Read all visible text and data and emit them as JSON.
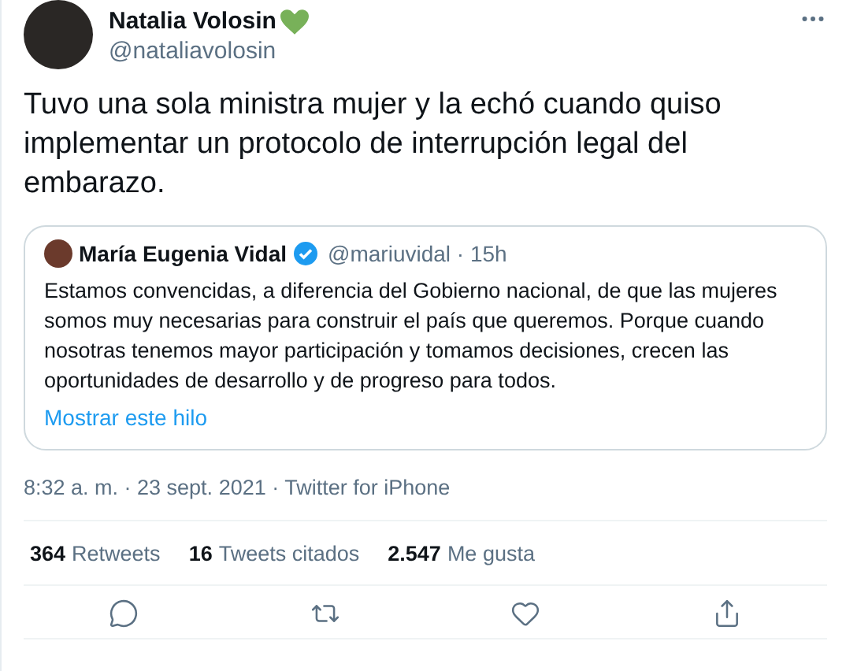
{
  "author": {
    "name": "Natalia Volosin",
    "handle": "@nataliavolosin"
  },
  "text": "Tuvo una sola ministra mujer y la echó cuando quiso implementar un protocolo de interrupción legal del embarazo.",
  "quoted": {
    "name": "María Eugenia Vidal",
    "verified": true,
    "handle": "@mariuvidal",
    "separator": "·",
    "time": "15h",
    "text": "Estamos convencidas, a diferencia del Gobierno nacional, de que las mujeres somos muy necesarias para construir el país que queremos. Porque cuando nosotras tenemos mayor participación y tomamos decisiones, crecen las oportunidades de desarrollo y de progreso para todos.",
    "link": "Mostrar este hilo"
  },
  "meta": "8:32 a. m. · 23 sept. 2021 · Twitter for iPhone",
  "stats": [
    {
      "count": "364",
      "label": "Retweets"
    },
    {
      "count": "16",
      "label": "Tweets citados"
    },
    {
      "count": "2.547",
      "label": "Me gusta"
    }
  ],
  "actions": [
    {
      "kind": "reply"
    },
    {
      "kind": "retweet"
    },
    {
      "kind": "like"
    },
    {
      "kind": "share"
    }
  ]
}
